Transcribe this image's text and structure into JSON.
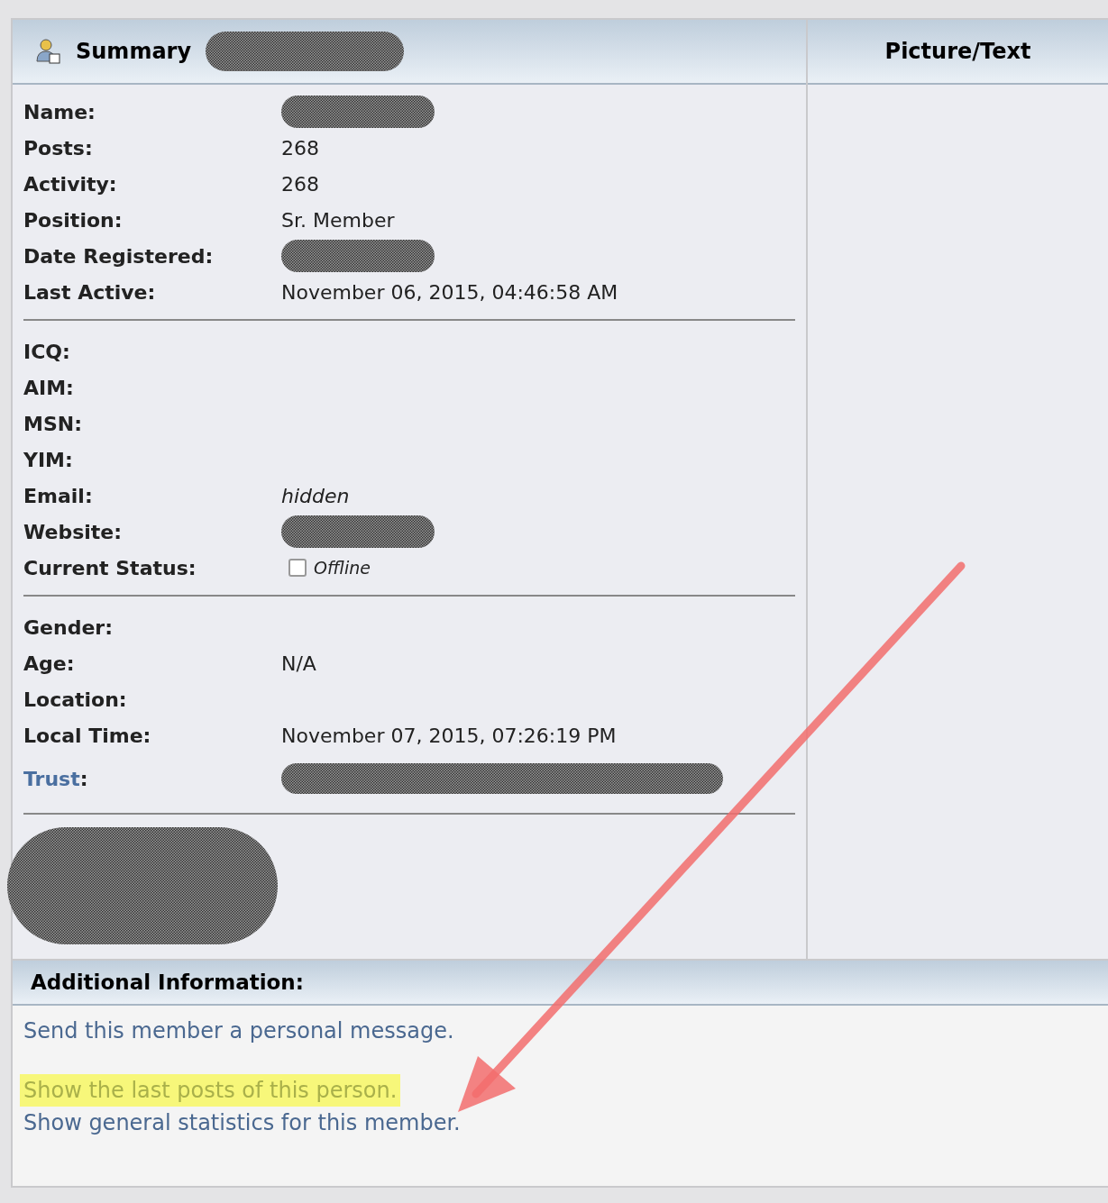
{
  "header": {
    "title": "Summary",
    "side_title": "Picture/Text"
  },
  "sections": [
    {
      "fields": [
        {
          "label": "Name:",
          "kind": "redacted"
        },
        {
          "label": "Posts:",
          "kind": "text",
          "value": "268"
        },
        {
          "label": "Activity:",
          "kind": "text",
          "value": "268"
        },
        {
          "label": "Position:",
          "kind": "text",
          "value": "Sr. Member"
        },
        {
          "label": "Date Registered:",
          "kind": "redacted"
        },
        {
          "label": "Last Active:",
          "kind": "text",
          "value": "November 06, 2015, 04:46:58 AM"
        }
      ]
    },
    {
      "fields": [
        {
          "label": "ICQ:",
          "kind": "empty"
        },
        {
          "label": "AIM:",
          "kind": "empty"
        },
        {
          "label": "MSN:",
          "kind": "empty"
        },
        {
          "label": "YIM:",
          "kind": "empty"
        },
        {
          "label": "Email:",
          "kind": "italic",
          "value": "hidden"
        },
        {
          "label": "Website:",
          "kind": "redacted"
        },
        {
          "label": "Current Status:",
          "kind": "status",
          "value": "Offline"
        }
      ]
    },
    {
      "fields": [
        {
          "label": "Gender:",
          "kind": "empty"
        },
        {
          "label": "Age:",
          "kind": "text",
          "value": "N/A"
        },
        {
          "label": "Location:",
          "kind": "empty"
        },
        {
          "label": "Local Time:",
          "kind": "text",
          "value": "November 07, 2015, 07:26:19 PM"
        },
        {
          "label": "Trust",
          "label_suffix": ":",
          "kind": "link_redacted"
        }
      ]
    }
  ],
  "additional": {
    "title": "Additional Information:",
    "links": [
      {
        "text": "Send this member a personal message.",
        "highlighted": false
      },
      {
        "text": "Show the last posts of this person.",
        "highlighted": true
      },
      {
        "text": "Show general statistics for this member.",
        "highlighted": false
      }
    ]
  }
}
